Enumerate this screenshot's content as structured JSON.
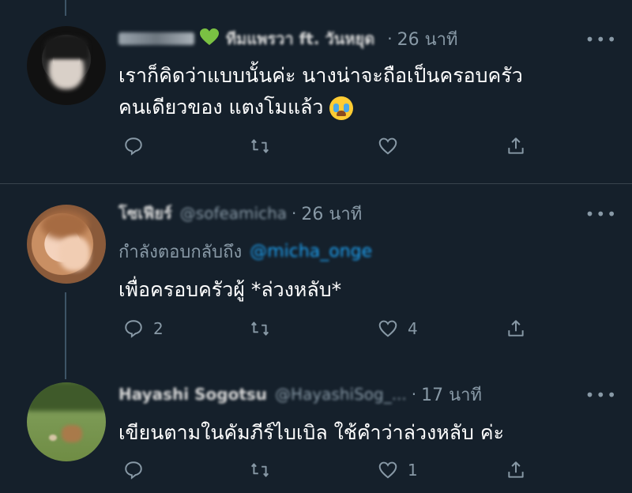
{
  "tweets": [
    {
      "name": "ทีมแพรวา ft. วันหยุด",
      "handle": "",
      "time": "26 นาที",
      "text_lines": [
        "เราก็คิดว่าแบบนั้นค่ะ นางน่าจะถือเป็นครอบครัว",
        "คนเดียวของ แตงโมแล้ว"
      ],
      "emoji": "loudly-crying-face",
      "reply_count": "",
      "retweet_count": "",
      "like_count": ""
    },
    {
      "name": "โซเฟียร์",
      "handle": "@sofeamicha",
      "time": "26 นาที",
      "replying_to_label": "กำลังตอบกลับถึง",
      "replying_to_handle": "@micha_onge",
      "text": "เพื่อครอบครัวผู้  *ล่วงหลับ*",
      "reply_count": "2",
      "retweet_count": "",
      "like_count": "4"
    },
    {
      "name": "Hayashi Sogotsu",
      "handle": "@HayashiSog_...",
      "time": "17 นาที",
      "text": "เขียนตามในคัมภีร์ไบเบิล ใช้คำว่าล่วงหลับ ค่ะ",
      "reply_count": "",
      "retweet_count": "",
      "like_count": "1"
    }
  ],
  "colors": {
    "background": "#15202b",
    "divider": "#38444d",
    "secondary_text": "#8899a6",
    "link": "#1da1f2"
  },
  "icons": [
    "reply-icon",
    "retweet-icon",
    "like-icon",
    "share-icon",
    "more-icon"
  ]
}
